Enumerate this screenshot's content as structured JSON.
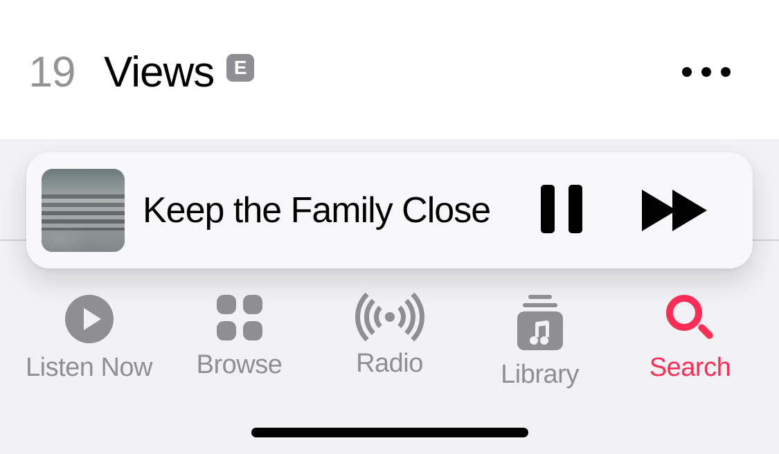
{
  "colors": {
    "accent": "#ff2d55",
    "inactive": "#8e8e93"
  },
  "track": {
    "index": "19",
    "title": "Views",
    "explicit_badge": "E"
  },
  "now_playing": {
    "title": "Keep the Family Close"
  },
  "tabs": {
    "listen_now": "Listen Now",
    "browse": "Browse",
    "radio": "Radio",
    "library": "Library",
    "search": "Search",
    "active": "search"
  }
}
